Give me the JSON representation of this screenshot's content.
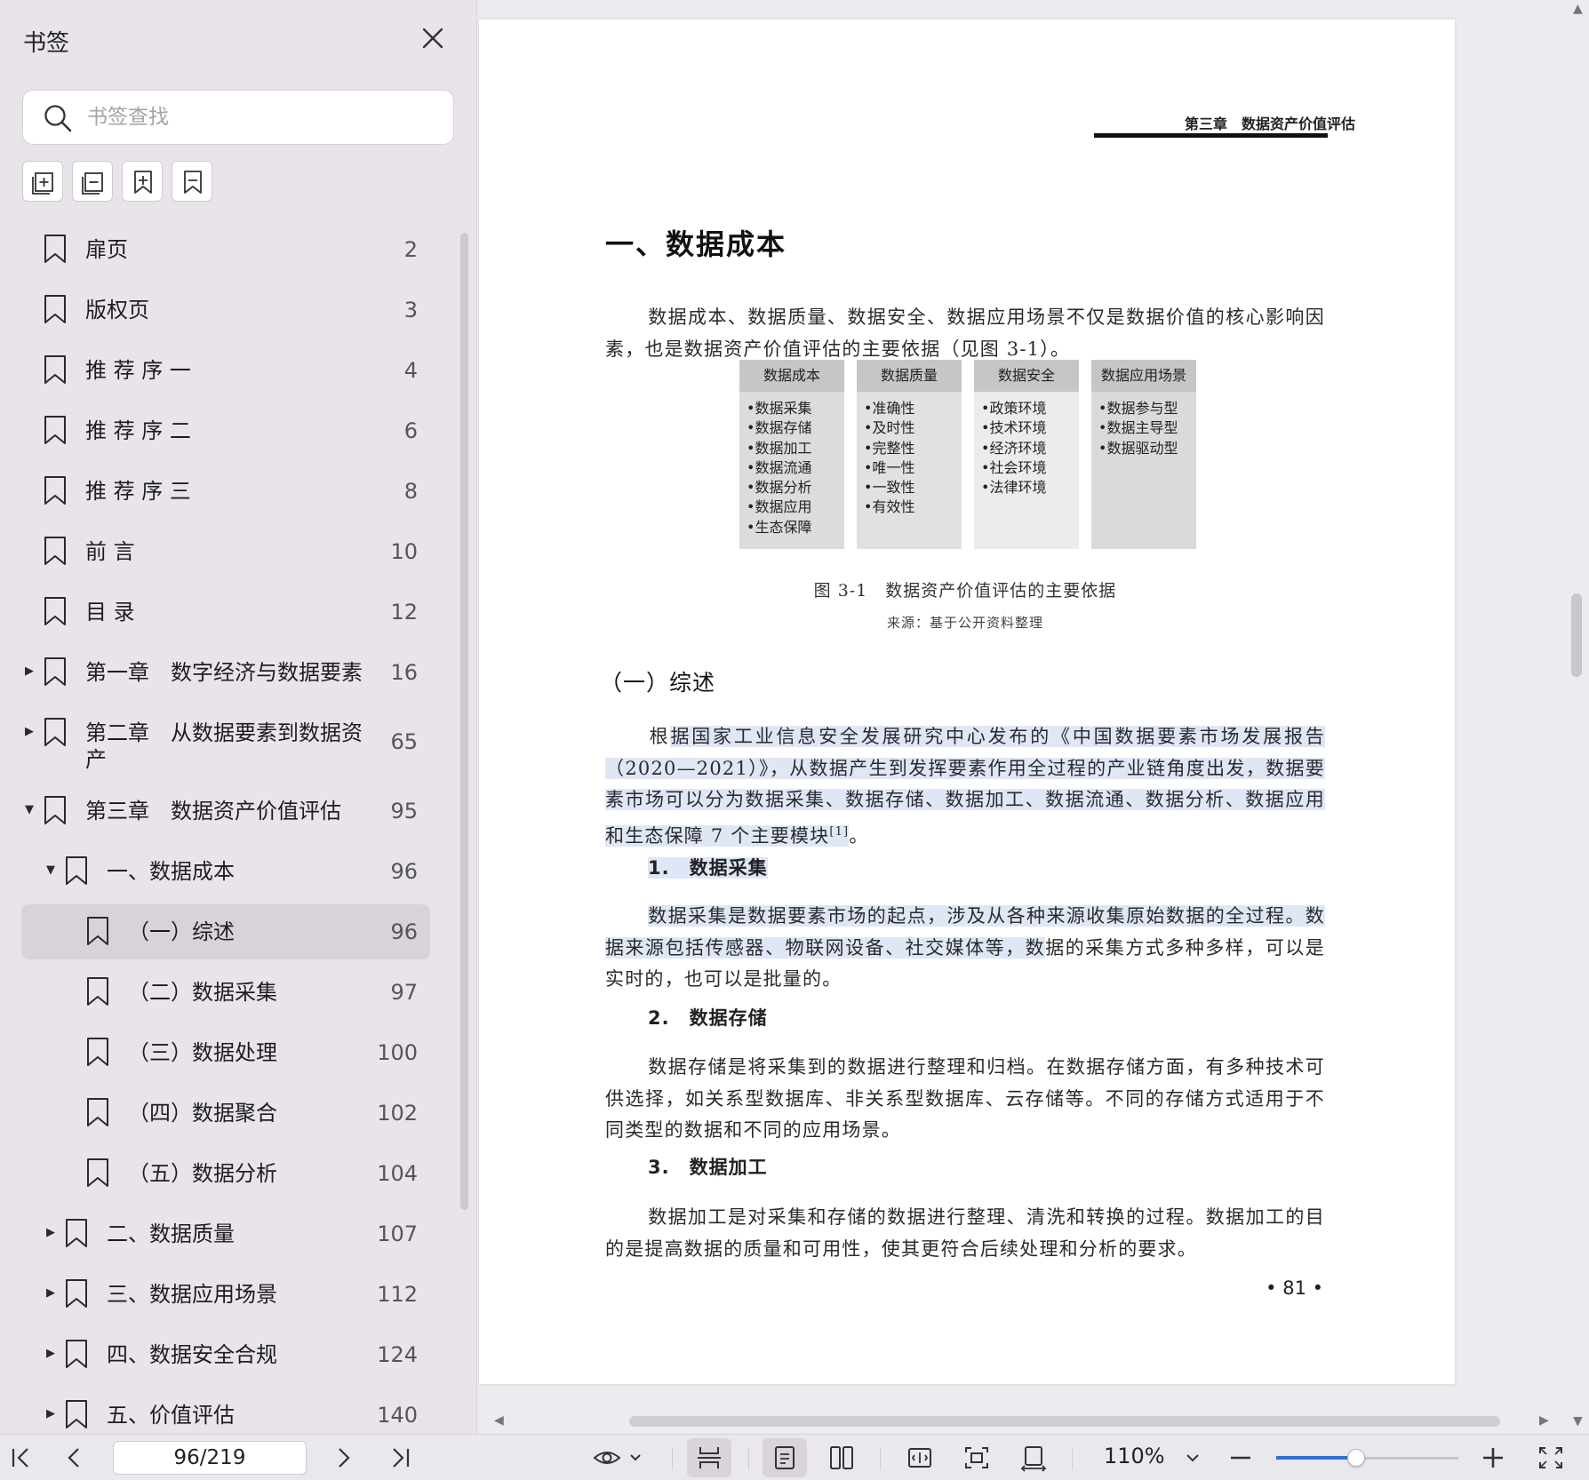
{
  "sidebar": {
    "title": "书签",
    "search_placeholder": "书签查找",
    "tools": [
      "expand-all-icon",
      "collapse-all-icon",
      "add-bookmark-icon",
      "remove-bookmark-icon"
    ],
    "items": [
      {
        "label": "扉页",
        "page": "2",
        "level": 0,
        "caret": ""
      },
      {
        "label": "版权页",
        "page": "3",
        "level": 0,
        "caret": ""
      },
      {
        "label": "推 荐 序 一",
        "page": "4",
        "level": 0,
        "caret": ""
      },
      {
        "label": "推 荐 序 二",
        "page": "6",
        "level": 0,
        "caret": ""
      },
      {
        "label": "推 荐 序 三",
        "page": "8",
        "level": 0,
        "caret": ""
      },
      {
        "label": "前 言",
        "page": "10",
        "level": 0,
        "caret": ""
      },
      {
        "label": "目 录",
        "page": "12",
        "level": 0,
        "caret": ""
      },
      {
        "label": "第一章　数字经济与数据要素",
        "page": "16",
        "level": 0,
        "caret": "collapsed"
      },
      {
        "label": "第二章　从数据要素到数据资",
        "label2": "产",
        "page": "65",
        "level": 0,
        "caret": "collapsed"
      },
      {
        "label": "第三章　数据资产价值评估",
        "page": "95",
        "level": 0,
        "caret": "expanded"
      },
      {
        "label": "一、数据成本",
        "page": "96",
        "level": 1,
        "caret": "expanded"
      },
      {
        "label": "（一）综述",
        "page": "96",
        "level": 2,
        "caret": "",
        "selected": true
      },
      {
        "label": "（二）数据采集",
        "page": "97",
        "level": 2,
        "caret": ""
      },
      {
        "label": "（三）数据处理",
        "page": "100",
        "level": 2,
        "caret": ""
      },
      {
        "label": "（四）数据聚合",
        "page": "102",
        "level": 2,
        "caret": ""
      },
      {
        "label": "（五）数据分析",
        "page": "104",
        "level": 2,
        "caret": ""
      },
      {
        "label": "二、数据质量",
        "page": "107",
        "level": 1,
        "caret": "collapsed"
      },
      {
        "label": "三、数据应用场景",
        "page": "112",
        "level": 1,
        "caret": "collapsed"
      },
      {
        "label": "四、数据安全合规",
        "page": "124",
        "level": 1,
        "caret": "collapsed"
      },
      {
        "label": "五、价值评估",
        "page": "140",
        "level": 1,
        "caret": "collapsed"
      }
    ]
  },
  "document": {
    "running_head": "第三章　数据资产价值评估",
    "h1": "一、数据成本",
    "intro": "数据成本、数据质量、数据安全、数据应用场景不仅是数据价值的核心影响因素，也是数据资产价值评估的主要依据（见图 3-1）。",
    "figure": {
      "columns": [
        {
          "head": "数据成本",
          "items": [
            "•数据采集",
            "•数据存储",
            "•数据加工",
            "•数据流通",
            "•数据分析",
            "•数据应用",
            "•生态保障"
          ]
        },
        {
          "head": "数据质量",
          "items": [
            "•准确性",
            "•及时性",
            "•完整性",
            "•唯一性",
            "•一致性",
            "•有效性"
          ]
        },
        {
          "head": "数据安全",
          "items": [
            "•政策环境",
            "•技术环境",
            "•经济环境",
            "•社会环境",
            "•法律环境"
          ]
        },
        {
          "head": "数据应用场景",
          "items": [
            "•数据参与型",
            "•数据主导型",
            "•数据驱动型"
          ]
        }
      ],
      "caption": "图 3-1　数据资产价值评估的主要依据",
      "source": "来源：基于公开资料整理"
    },
    "h2": "（一）综述",
    "para1_pre": "根",
    "para1_hl": "据国家工业信息安全发展研究中心发布的《中国数据要素市场发展报告（2020—2021）》，从数据产生到发挥要素作用全过程的产业链角度出发，数据要素市场可以分为数据采集、数据存储、数据加工、数据流通、数据分析、数据应用和生态保障 7 个主要模块",
    "para1_ref": "[1]",
    "para1_end": "。",
    "h3_1": "1.　数据采集",
    "para2_hl": "数据采集是数据要素市场的起点，涉及从各种来源收集原始数据的全过程。数据来源包括传感器、物联网设备、社交媒体等，数",
    "para2_rest": "据的采集方式多种多样，可以是实时的，也可以是批量的。",
    "h3_2": "2.　数据存储",
    "para3": "数据存储是将采集到的数据进行整理和归档。在数据存储方面，有多种技术可供选择，如关系型数据库、非关系型数据库、云存储等。不同的存储方式适用于不同类型的数据和不同的应用场景。",
    "h3_3": "3.　数据加工",
    "para4": "数据加工是对采集和存储的数据进行整理、清洗和转换的过程。数据加工的目的是提高数据的质量和可用性，使其更符合后续处理和分析的要求。",
    "page_number": "• 81 •"
  },
  "toolbar": {
    "page_indicator": "96/219",
    "zoom": "110%",
    "zoom_slider_fraction": 0.44,
    "colors": {
      "accent": "#2f6fe0",
      "highlight": "#dfe7f7",
      "selected_row": "#d8d3d9"
    }
  }
}
